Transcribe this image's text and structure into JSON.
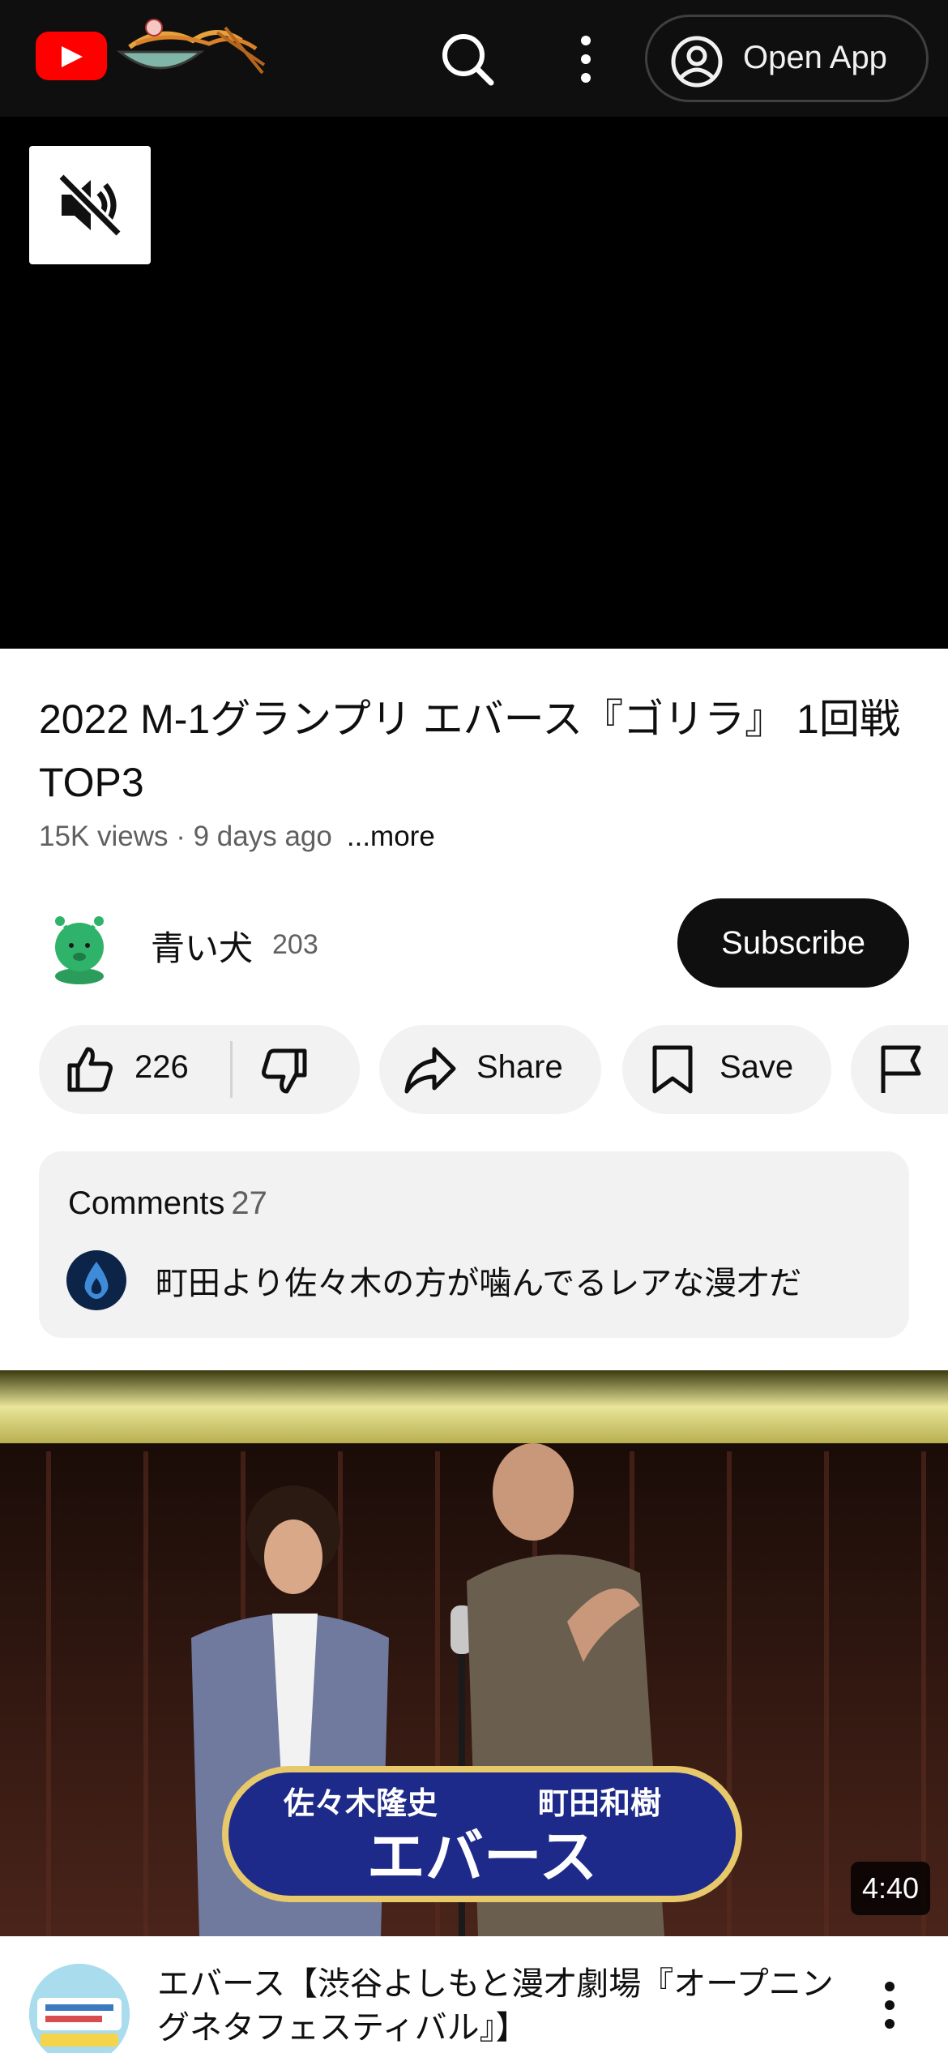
{
  "header": {
    "logo_icon": "youtube-logo-icon",
    "doodle_icon": "ramen-doodle-icon",
    "search_icon": "search-icon",
    "more_icon": "more-vert-icon",
    "open_app_label": "Open App",
    "account_icon": "account-circle-icon"
  },
  "player": {
    "mute_icon": "volume-off-icon"
  },
  "video": {
    "title": "2022 M-1グランプリ エバース『ゴリラ』 1回戦TOP3",
    "meta": "15K views · 9 days ago",
    "more_label": "...more"
  },
  "channel": {
    "name": "青い犬",
    "subscriber_count": "203",
    "subscribe_label": "Subscribe"
  },
  "actions": {
    "like_count": "226",
    "share_label": "Share",
    "save_label": "Save"
  },
  "comments": {
    "header_label": "Comments",
    "count": "27",
    "top_comment": "町田より佐々木の方が噛んでるレアな漫才だ"
  },
  "next_video": {
    "thumbnail_caption_names": [
      "佐々木隆史",
      "町田和樹"
    ],
    "thumbnail_caption_title": "エバース",
    "duration": "4:40",
    "title": "エバース【渋谷よしもと漫才劇場『オープニングネタフェスティバル』】"
  },
  "colors": {
    "brand_red": "#ff0000",
    "header_bg": "#0f0f0f",
    "chip_bg": "#f2f2f2",
    "subscribe_bg": "#0f0f0f"
  }
}
